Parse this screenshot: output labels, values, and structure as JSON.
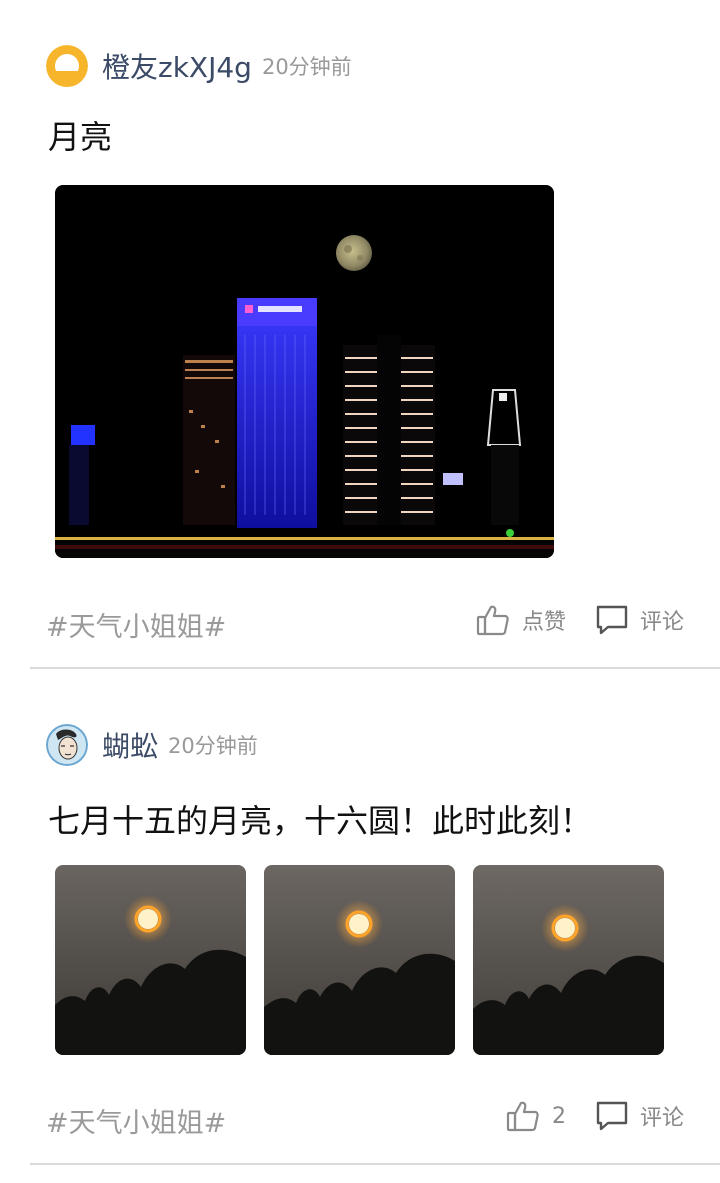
{
  "posts": [
    {
      "username": "橙友zkXJ4g",
      "time": "20分钟前",
      "text": "月亮",
      "tag": "#天气小姐姐#",
      "like_label": "点赞",
      "comment_label": "评论",
      "avatar_icon": "default-user-avatar-icon",
      "image_subjects": [
        "night-city-skyline-full-moon"
      ]
    },
    {
      "username": "蝴蚣",
      "time": "20分钟前",
      "text": "七月十五的月亮，十六圆！此时此刻！",
      "tag": "#天气小姐姐#",
      "like_label": "2",
      "comment_label": "评论",
      "avatar_icon": "illustrated-face-avatar",
      "image_subjects": [
        "orange-moon-over-trees",
        "orange-moon-over-trees",
        "orange-moon-over-trees"
      ]
    }
  ],
  "colors": {
    "username": "#3b4a66",
    "meta_gray": "#999999",
    "avatar_orange": "#f7b52c",
    "divider": "#d9d9d9"
  }
}
